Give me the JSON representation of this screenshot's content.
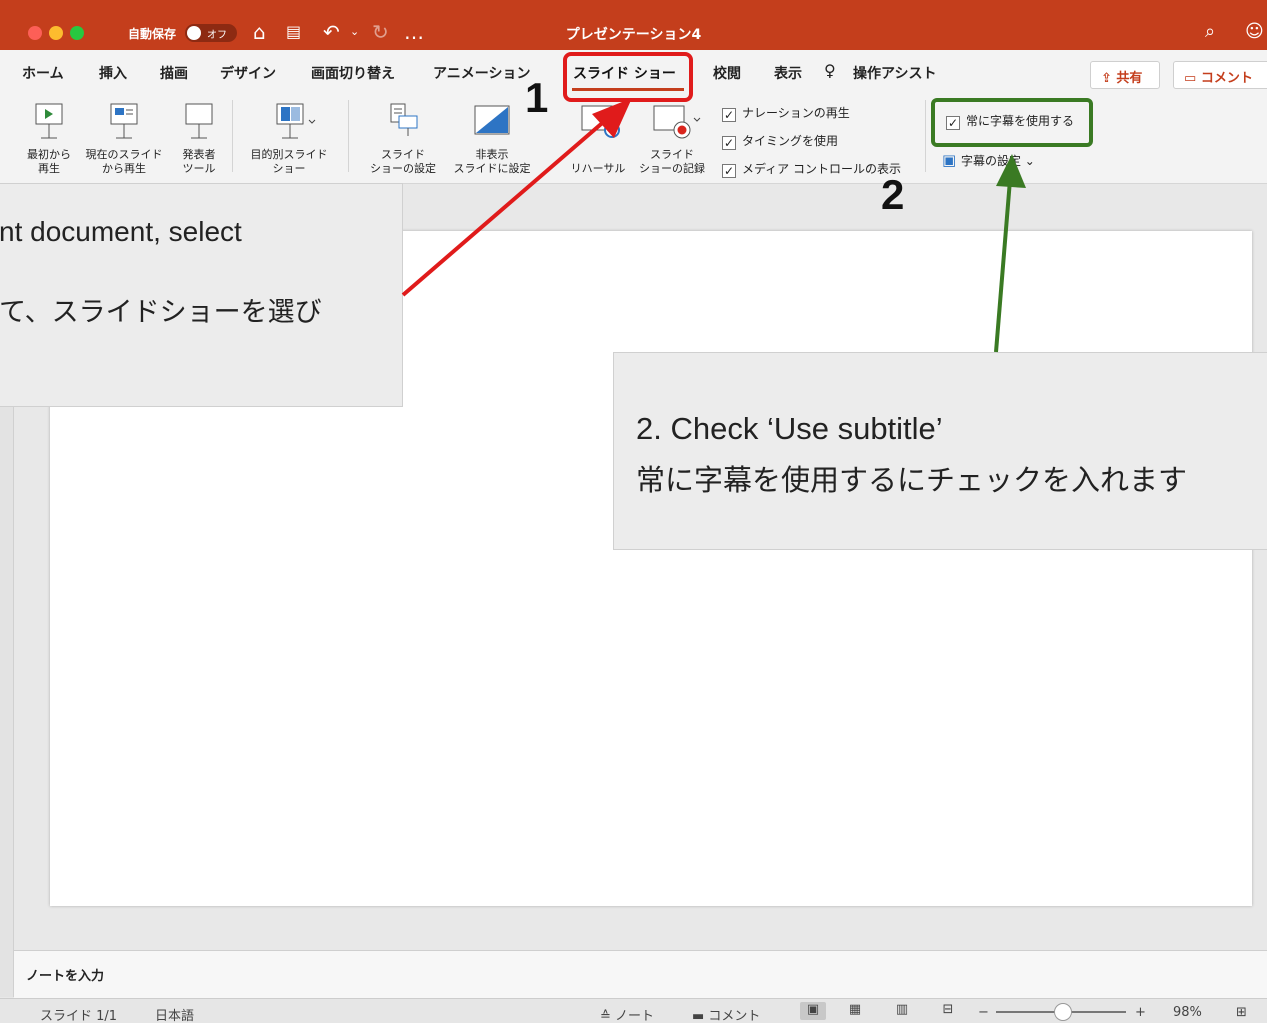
{
  "titlebar": {
    "autosave_label": "自動保存",
    "autosave_state": "オフ",
    "doc_title": "プレゼンテーション4",
    "more": "…"
  },
  "tabs": [
    {
      "label": "ホーム"
    },
    {
      "label": "挿入"
    },
    {
      "label": "描画"
    },
    {
      "label": "デザイン"
    },
    {
      "label": "画面切り替え"
    },
    {
      "label": "アニメーション"
    },
    {
      "label": "スライド ショー",
      "active": true
    },
    {
      "label": "校閲"
    },
    {
      "label": "表示"
    },
    {
      "label": "操作アシスト"
    }
  ],
  "header_buttons": {
    "share": "共有",
    "comment": "コメント"
  },
  "ribbon": {
    "from_beginning": "最初から\n再生",
    "from_current": "現在のスライド\nから再生",
    "presenter_tools": "発表者\nツール",
    "custom_show": "目的別スライド\nショー",
    "setup_show": "スライド\nショーの設定",
    "hide_slide": "非表示\nスライドに設定",
    "rehearse": "リハーサル",
    "record_show": "スライド\nショーの記録",
    "play_narration": "ナレーションの再生",
    "use_timings": "タイミングを使用",
    "show_media_controls": "メディア コントロールの表示",
    "always_use_subtitles": "常に字幕を使用する",
    "subtitle_settings": "字幕の設定"
  },
  "annotations": {
    "step1_number": "1",
    "step2_number": "2",
    "callout1_line1": "nt document, select",
    "callout1_line2": "て、スライドショーを選び",
    "callout2_line1": "2. Check ‘Use subtitle’",
    "callout2_line2": "常に字幕を使用するにチェックを入れます"
  },
  "notes_placeholder": "ノートを入力",
  "statusbar": {
    "slide_counter": "スライド 1/1",
    "language": "日本語",
    "notes": "ノート",
    "comments": "コメント",
    "zoom": "98%"
  },
  "colors": {
    "accent": "#c43e1c",
    "highlight_red": "#e01b1b",
    "highlight_green": "#3a7a23"
  }
}
